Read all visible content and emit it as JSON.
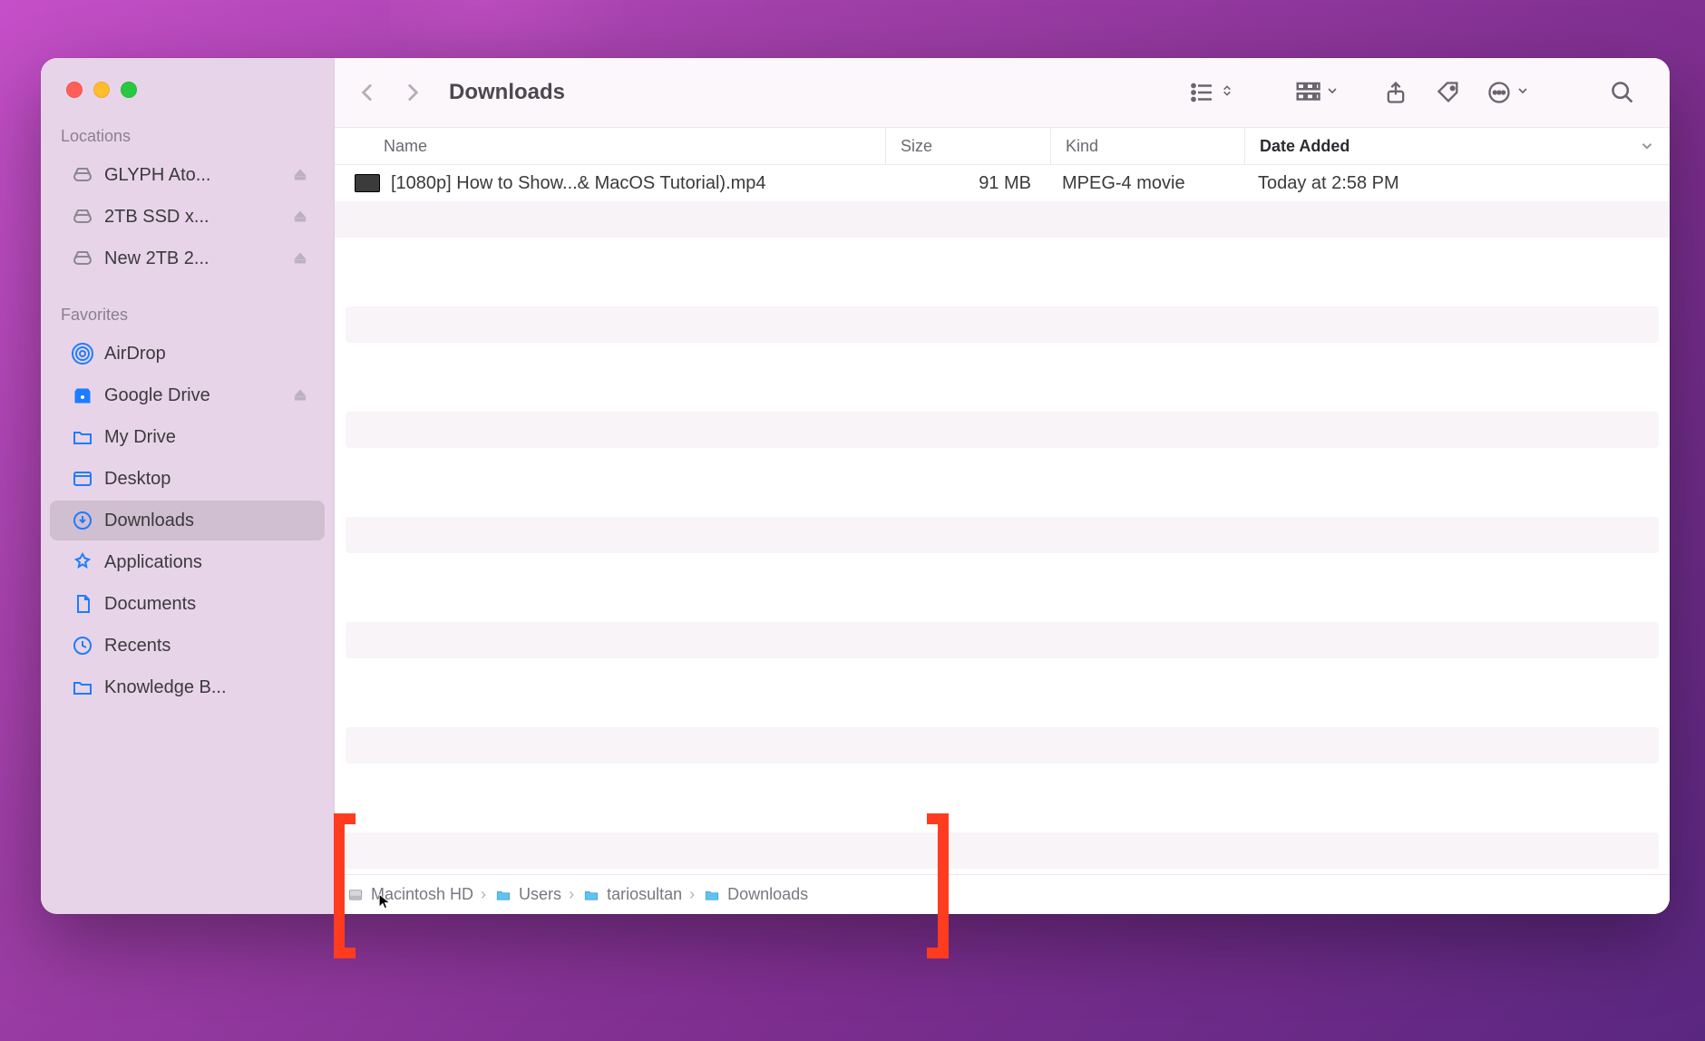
{
  "window_title": "Downloads",
  "sidebar": {
    "sections": {
      "locations_label": "Locations",
      "favorites_label": "Favorites"
    },
    "locations": [
      {
        "label": "GLYPH Ato...",
        "eject": true
      },
      {
        "label": "2TB SSD x...",
        "eject": true
      },
      {
        "label": "New 2TB 2...",
        "eject": true
      }
    ],
    "favorites": [
      {
        "label": "AirDrop"
      },
      {
        "label": "Google Drive",
        "eject": true
      },
      {
        "label": "My Drive"
      },
      {
        "label": "Desktop"
      },
      {
        "label": "Downloads",
        "selected": true
      },
      {
        "label": "Applications"
      },
      {
        "label": "Documents"
      },
      {
        "label": "Recents"
      },
      {
        "label": "Knowledge B..."
      }
    ]
  },
  "columns": {
    "name": "Name",
    "size": "Size",
    "kind": "Kind",
    "date_added": "Date Added"
  },
  "files": [
    {
      "name": "[1080p] How to Show...& MacOS Tutorial).mp4",
      "size": "91 MB",
      "kind": "MPEG-4 movie",
      "date_added": "Today at 2:58 PM"
    }
  ],
  "path": [
    {
      "label": "Macintosh HD",
      "type": "disk"
    },
    {
      "label": "Users",
      "type": "folder"
    },
    {
      "label": "tariosultan",
      "type": "folder"
    },
    {
      "label": "Downloads",
      "type": "folder"
    }
  ]
}
